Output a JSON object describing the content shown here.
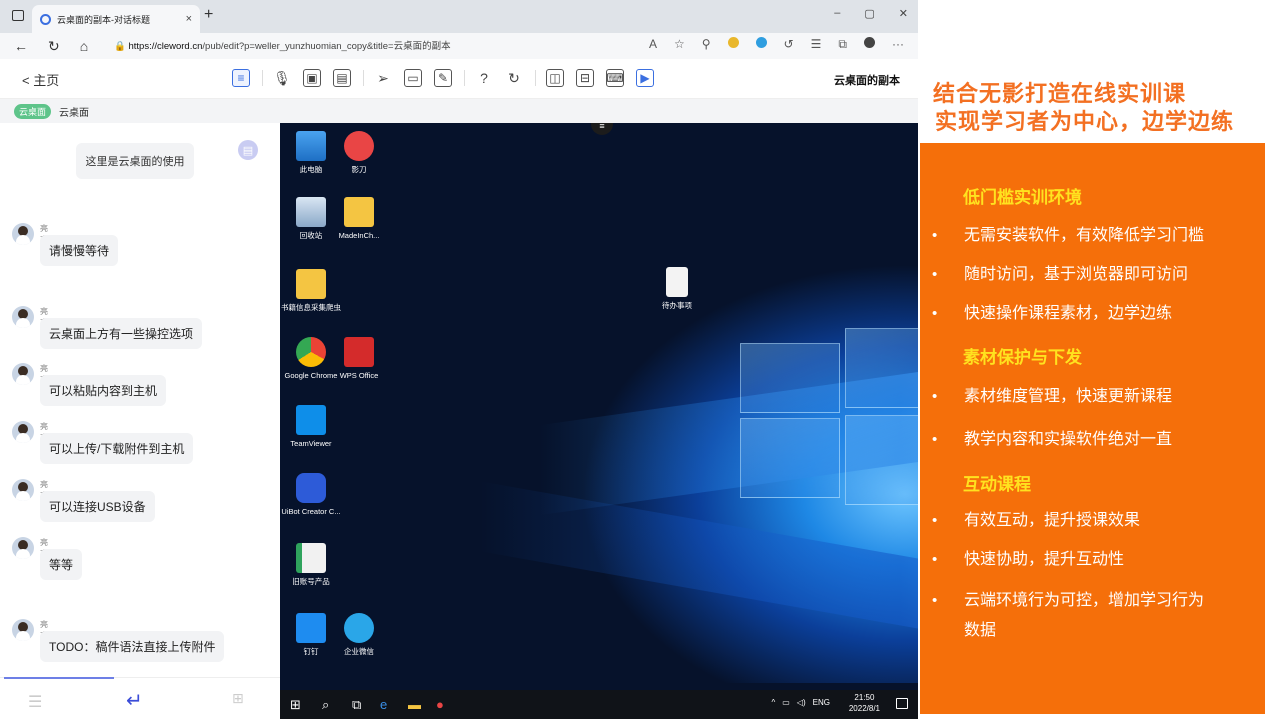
{
  "browser": {
    "tab_title": "云桌面的副本-对话标题",
    "tab_close": "×",
    "new_tab": "+",
    "url_host": "https://cleword.cn",
    "url_path": "/pub/edit?p=weller_yunzhuomian_copy&title=云桌面的副本",
    "win_min": "–",
    "win_max": "▢",
    "win_close": "✕"
  },
  "toolbar": {
    "back_label": "< 主页",
    "doc_title": "云桌面的副本"
  },
  "breadcrumb": {
    "tag": "云桌面",
    "label": "云桌面"
  },
  "chat": {
    "header_text": "这里是云桌面的使用",
    "messages": [
      {
        "user": "亮亮",
        "text": "请慢慢等待"
      },
      {
        "user": "亮亮",
        "text": "云桌面上方有一些操控选项"
      },
      {
        "user": "亮亮",
        "text": "可以粘贴内容到主机"
      },
      {
        "user": "亮亮",
        "text": "可以上传/下载附件到主机"
      },
      {
        "user": "亮亮",
        "text": "可以连接USB设备"
      },
      {
        "user": "亮亮",
        "text": "等等"
      },
      {
        "user": "亮亮",
        "text": "TODO：稿件语法直接上传附件"
      }
    ]
  },
  "desktop": {
    "icons": [
      {
        "label": "此电脑"
      },
      {
        "label": "影刀"
      },
      {
        "label": "回收站"
      },
      {
        "label": "MadeInCh..."
      },
      {
        "label": "书籍信息采集爬虫"
      },
      {
        "label": "Google Chrome"
      },
      {
        "label": "WPS Office"
      },
      {
        "label": "TeamViewer"
      },
      {
        "label": "UiBot Creator C..."
      },
      {
        "label": "旧账号产品"
      },
      {
        "label": "钉钉"
      },
      {
        "label": "企业微信"
      },
      {
        "label": "待办事项"
      }
    ],
    "taskbar": {
      "tray": "ENG",
      "time": "21:50",
      "date": "2022/8/1"
    }
  },
  "slide": {
    "title_line1": "结合无影打造在线实训课",
    "title_line2_prefix": "实现",
    "title_line2_rest": "学习者为中心，边学边练",
    "sections": [
      {
        "heading": "低门槛实训环境",
        "items": [
          "无需安装软件，有效降低学习门槛",
          "随时访问，基于浏览器即可访问",
          "快速操作课程素材，边学边练"
        ]
      },
      {
        "heading": "素材保护与下发",
        "items": [
          "素材维度管理，快速更新课程",
          "教学内容和实操软件绝对一直"
        ]
      },
      {
        "heading": "互动课程",
        "items": [
          "有效互动，提升授课效果",
          "快速协助，提升互动性",
          "云端环境行为可控，增加学习行为",
          "数据"
        ]
      }
    ],
    "bullet": "•"
  }
}
